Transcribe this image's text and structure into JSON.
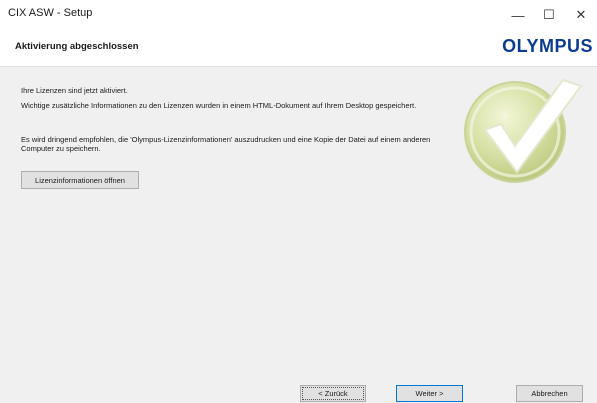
{
  "window": {
    "title": "CIX ASW - Setup",
    "controls": {
      "minimize": "—",
      "maximize": "☐",
      "close": "✕"
    }
  },
  "header": {
    "title": "Aktivierung abgeschlossen",
    "logo": "OLYMPUS"
  },
  "content": {
    "line1": "Ihre Lizenzen sind jetzt aktiviert.",
    "line2": "Wichtige zusätzliche Informationen zu den Lizenzen wurden in einem HTML-Dokument auf Ihrem Desktop gespeichert.",
    "line3": "Es wird dringend empfohlen, die 'Olympus-Lizenzinformationen' auszudrucken und eine Kopie der Datei auf einem anderen Computer zu speichern.",
    "open_button": "Lizenzinformationen öffnen",
    "status_icon": "checkmark-icon"
  },
  "footer": {
    "back": "< Zurück",
    "next": "Weiter >",
    "cancel": "Abbrechen"
  },
  "colors": {
    "logo": "#0b3c8f",
    "content_bg": "#f0f0f0",
    "default_button_border": "#0078d7"
  }
}
